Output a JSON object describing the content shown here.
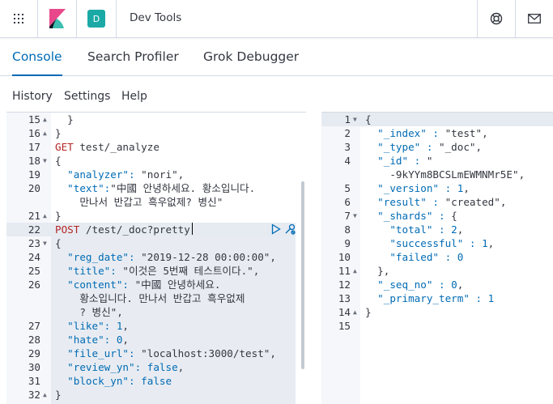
{
  "header": {
    "breadcrumb": "Dev Tools",
    "space_initial": "D",
    "icons": [
      "apps-grid-icon",
      "kibana-logo-icon",
      "help-lifebuoy-icon",
      "mail-icon"
    ]
  },
  "tabs": [
    {
      "label": "Console",
      "active": true
    },
    {
      "label": "Search Profiler",
      "active": false
    },
    {
      "label": "Grok Debugger",
      "active": false
    }
  ],
  "menu": [
    "History",
    "Settings",
    "Help"
  ],
  "request_editor": {
    "lines": [
      {
        "n": "15",
        "fold": "▲",
        "parts": [
          {
            "t": "  }",
            "c": "p"
          }
        ]
      },
      {
        "n": "16",
        "fold": "▲",
        "parts": [
          {
            "t": "}",
            "c": "p"
          }
        ]
      },
      {
        "n": "17",
        "fold": "",
        "parts": [
          {
            "t": "GET",
            "c": "k"
          },
          {
            "t": " test/_analyze",
            "c": "u"
          }
        ]
      },
      {
        "n": "18",
        "fold": "▼",
        "parts": [
          {
            "t": "{",
            "c": "p"
          }
        ]
      },
      {
        "n": "19",
        "fold": "",
        "parts": [
          {
            "t": "  \"analyzer\": ",
            "c": "s"
          },
          {
            "t": "\"nori\"",
            "c": "u"
          },
          {
            "t": ",",
            "c": "p"
          }
        ]
      },
      {
        "n": "20",
        "fold": "",
        "parts": [
          {
            "t": "  \"text\":",
            "c": "s"
          },
          {
            "t": "\"中國 안녕하세요. 황소입니다.",
            "c": "u"
          }
        ]
      },
      {
        "n": "",
        "fold": "",
        "parts": [
          {
            "t": "    만나서 반갑고 흑우없제? 병신\"",
            "c": "u"
          }
        ]
      },
      {
        "n": "21",
        "fold": "▲",
        "parts": [
          {
            "t": "}",
            "c": "p"
          }
        ]
      },
      {
        "n": "22",
        "fold": "",
        "parts": [
          {
            "t": "POST",
            "c": "k"
          },
          {
            "t": " /test/_doc?pretty",
            "c": "u"
          }
        ]
      },
      {
        "n": "23",
        "fold": "▼",
        "parts": [
          {
            "t": "{",
            "c": "p"
          }
        ]
      },
      {
        "n": "24",
        "fold": "",
        "parts": [
          {
            "t": "  \"reg_date\": ",
            "c": "s"
          },
          {
            "t": "\"2019-12-28 00:00:00\"",
            "c": "u"
          },
          {
            "t": ",",
            "c": "p"
          }
        ]
      },
      {
        "n": "25",
        "fold": "",
        "parts": [
          {
            "t": "  \"title\": ",
            "c": "s"
          },
          {
            "t": "\"이것은 5번째 테스트이다.\"",
            "c": "u"
          },
          {
            "t": ",",
            "c": "p"
          }
        ]
      },
      {
        "n": "26",
        "fold": "",
        "parts": [
          {
            "t": "  \"content\": ",
            "c": "s"
          },
          {
            "t": "\"中國 안녕하세요.",
            "c": "u"
          }
        ]
      },
      {
        "n": "",
        "fold": "",
        "parts": [
          {
            "t": "    황소입니다. 만나서 반갑고 흑우없제",
            "c": "u"
          }
        ]
      },
      {
        "n": "",
        "fold": "",
        "parts": [
          {
            "t": "    ? 병신\"",
            "c": "u"
          },
          {
            "t": ",",
            "c": "p"
          }
        ]
      },
      {
        "n": "27",
        "fold": "",
        "parts": [
          {
            "t": "  \"like\": ",
            "c": "s"
          },
          {
            "t": "1",
            "c": "n"
          },
          {
            "t": ",",
            "c": "p"
          }
        ]
      },
      {
        "n": "28",
        "fold": "",
        "parts": [
          {
            "t": "  \"hate\": ",
            "c": "s"
          },
          {
            "t": "0",
            "c": "n"
          },
          {
            "t": ",",
            "c": "p"
          }
        ]
      },
      {
        "n": "29",
        "fold": "",
        "parts": [
          {
            "t": "  \"file_url\": ",
            "c": "s"
          },
          {
            "t": "\"localhost:3000/test\"",
            "c": "u"
          },
          {
            "t": ",",
            "c": "p"
          }
        ]
      },
      {
        "n": "30",
        "fold": "",
        "parts": [
          {
            "t": "  \"review_yn\": ",
            "c": "s"
          },
          {
            "t": "false",
            "c": "kw"
          },
          {
            "t": ",",
            "c": "p"
          }
        ]
      },
      {
        "n": "31",
        "fold": "",
        "parts": [
          {
            "t": "  \"block_yn\": ",
            "c": "s"
          },
          {
            "t": "false",
            "c": "kw"
          }
        ]
      },
      {
        "n": "32",
        "fold": "▲",
        "parts": [
          {
            "t": "}",
            "c": "p"
          }
        ]
      }
    ]
  },
  "response_editor": {
    "lines": [
      {
        "n": "1",
        "fold": "▼",
        "parts": [
          {
            "t": "{",
            "c": "p"
          }
        ]
      },
      {
        "n": "2",
        "fold": "",
        "parts": [
          {
            "t": "  \"_index\" : ",
            "c": "s"
          },
          {
            "t": "\"test\"",
            "c": "u"
          },
          {
            "t": ",",
            "c": "p"
          }
        ]
      },
      {
        "n": "3",
        "fold": "",
        "parts": [
          {
            "t": "  \"_type\" : ",
            "c": "s"
          },
          {
            "t": "\"_doc\"",
            "c": "u"
          },
          {
            "t": ",",
            "c": "p"
          }
        ]
      },
      {
        "n": "4",
        "fold": "",
        "parts": [
          {
            "t": "  \"_id\" : ",
            "c": "s"
          },
          {
            "t": "\"",
            "c": "u"
          }
        ]
      },
      {
        "n": "",
        "fold": "",
        "parts": [
          {
            "t": "    -9kYYm8BCSLmEWMNMr5E\"",
            "c": "u"
          },
          {
            "t": ",",
            "c": "p"
          }
        ]
      },
      {
        "n": "5",
        "fold": "",
        "parts": [
          {
            "t": "  \"_version\" : ",
            "c": "s"
          },
          {
            "t": "1",
            "c": "n"
          },
          {
            "t": ",",
            "c": "p"
          }
        ]
      },
      {
        "n": "6",
        "fold": "",
        "parts": [
          {
            "t": "  \"result\" : ",
            "c": "s"
          },
          {
            "t": "\"created\"",
            "c": "u"
          },
          {
            "t": ",",
            "c": "p"
          }
        ]
      },
      {
        "n": "7",
        "fold": "▼",
        "parts": [
          {
            "t": "  \"_shards\" : ",
            "c": "s"
          },
          {
            "t": "{",
            "c": "p"
          }
        ]
      },
      {
        "n": "8",
        "fold": "",
        "parts": [
          {
            "t": "    \"total\" : ",
            "c": "s"
          },
          {
            "t": "2",
            "c": "n"
          },
          {
            "t": ",",
            "c": "p"
          }
        ]
      },
      {
        "n": "9",
        "fold": "",
        "parts": [
          {
            "t": "    \"successful\" : ",
            "c": "s"
          },
          {
            "t": "1",
            "c": "n"
          },
          {
            "t": ",",
            "c": "p"
          }
        ]
      },
      {
        "n": "10",
        "fold": "",
        "parts": [
          {
            "t": "    \"failed\" : ",
            "c": "s"
          },
          {
            "t": "0",
            "c": "n"
          }
        ]
      },
      {
        "n": "11",
        "fold": "▲",
        "parts": [
          {
            "t": "  }",
            "c": "p"
          },
          {
            "t": ",",
            "c": "p"
          }
        ]
      },
      {
        "n": "12",
        "fold": "",
        "parts": [
          {
            "t": "  \"_seq_no\" : ",
            "c": "s"
          },
          {
            "t": "0",
            "c": "n"
          },
          {
            "t": ",",
            "c": "p"
          }
        ]
      },
      {
        "n": "13",
        "fold": "",
        "parts": [
          {
            "t": "  \"_primary_term\" : ",
            "c": "s"
          },
          {
            "t": "1",
            "c": "n"
          }
        ]
      },
      {
        "n": "14",
        "fold": "▲",
        "parts": [
          {
            "t": "}",
            "c": "p"
          }
        ]
      },
      {
        "n": "15",
        "fold": "",
        "parts": []
      }
    ]
  },
  "colors": {
    "accent": "#006bb4",
    "method": "#b52525",
    "string": "#343741",
    "key": "#006bb4"
  }
}
